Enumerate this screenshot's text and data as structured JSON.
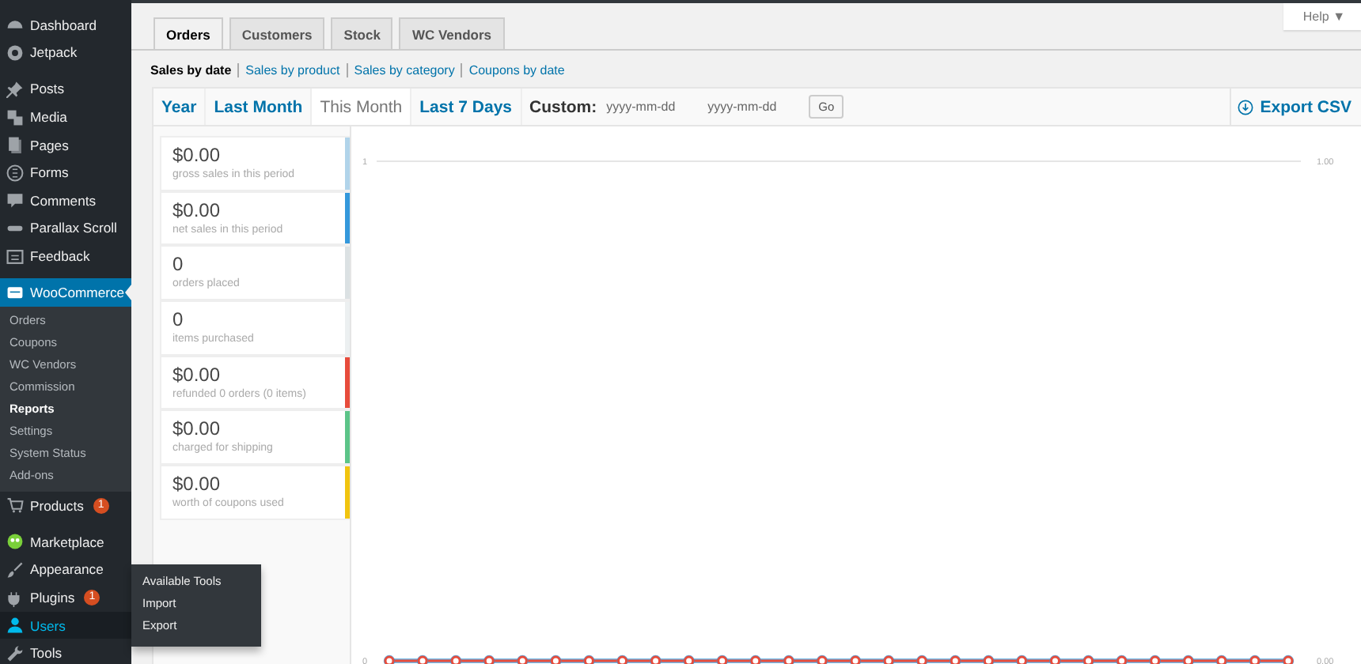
{
  "sidebar": {
    "items": [
      {
        "kind": "item",
        "label": "Dashboard",
        "selected": false
      },
      {
        "kind": "item",
        "label": "Jetpack",
        "selected": false
      },
      {
        "kind": "separator"
      },
      {
        "kind": "item",
        "label": "Posts",
        "selected": false
      },
      {
        "kind": "item",
        "label": "Media",
        "selected": false
      },
      {
        "kind": "item",
        "label": "Pages",
        "selected": false
      },
      {
        "kind": "item",
        "label": "Forms",
        "selected": false
      },
      {
        "kind": "item",
        "label": "Comments",
        "selected": false
      },
      {
        "kind": "item",
        "label": "Parallax Scroll",
        "selected": false
      },
      {
        "kind": "item",
        "label": "Feedback",
        "selected": false
      },
      {
        "kind": "separator"
      },
      {
        "kind": "item",
        "label": "WooCommerce",
        "selected": true,
        "submenu": [
          {
            "label": "Orders",
            "selected": false
          },
          {
            "label": "Coupons",
            "selected": false
          },
          {
            "label": "WC Vendors",
            "selected": false
          },
          {
            "label": "Commission",
            "selected": false
          },
          {
            "label": "Reports",
            "selected": true
          },
          {
            "label": "Settings",
            "selected": false
          },
          {
            "label": "System Status",
            "selected": false
          },
          {
            "label": "Add-ons",
            "selected": false
          }
        ]
      },
      {
        "kind": "item",
        "label": "Products",
        "selected": false,
        "badge": "1"
      },
      {
        "kind": "separator"
      },
      {
        "kind": "item",
        "label": "Marketplace",
        "selected": false
      },
      {
        "kind": "item",
        "label": "Appearance",
        "selected": false
      },
      {
        "kind": "item",
        "label": "Plugins",
        "selected": false,
        "badge": "1"
      },
      {
        "kind": "item",
        "label": "Users",
        "selected": false,
        "hovered": true,
        "flyout": [
          "Available Tools",
          "Import",
          "Export"
        ]
      },
      {
        "kind": "item",
        "label": "Tools",
        "selected": false
      }
    ]
  },
  "help": {
    "label": "Help ▼"
  },
  "tabs": [
    {
      "label": "Orders",
      "selected": true
    },
    {
      "label": "Customers",
      "selected": false
    },
    {
      "label": "Stock",
      "selected": false
    },
    {
      "label": "WC Vendors",
      "selected": false
    }
  ],
  "report_links": [
    {
      "label": "Sales by date",
      "selected": true
    },
    {
      "label": "Sales by product",
      "selected": false
    },
    {
      "label": "Sales by category",
      "selected": false
    },
    {
      "label": "Coupons by date",
      "selected": false
    }
  ],
  "ranges": [
    {
      "label": "Year",
      "selected": false
    },
    {
      "label": "Last Month",
      "selected": false
    },
    {
      "label": "This Month",
      "selected": true
    },
    {
      "label": "Last 7 Days",
      "selected": false
    }
  ],
  "custom": {
    "label": "Custom:",
    "from": {
      "placeholder": "yyyy-mm-dd"
    },
    "to": {
      "placeholder": "yyyy-mm-dd"
    },
    "button": "Go"
  },
  "export": {
    "label": "Export CSV"
  },
  "legend": [
    {
      "value": "$0.00",
      "caption": "gross sales in this period",
      "color": "#b1d4ea"
    },
    {
      "value": "$0.00",
      "caption": "net sales in this period",
      "color": "#3498db"
    },
    {
      "value": "0",
      "caption": "orders placed",
      "color": "#dbe1e3"
    },
    {
      "value": "0",
      "caption": "items purchased",
      "color": "#ecf0f1"
    },
    {
      "value": "$0.00",
      "caption": "refunded 0 orders (0 items)",
      "color": "#e74c3c"
    },
    {
      "value": "$0.00",
      "caption": "charged for shipping",
      "color": "#5cc488"
    },
    {
      "value": "$0.00",
      "caption": "worth of coupons used",
      "color": "#f1c40f"
    }
  ],
  "chart": {
    "left_axis_labels": [
      "1",
      "0"
    ],
    "right_axis_labels": [
      "1.00",
      "0.00"
    ]
  }
}
